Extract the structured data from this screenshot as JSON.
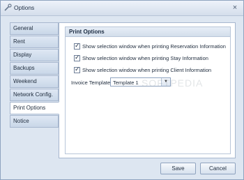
{
  "window": {
    "title": "Options",
    "close_symbol": "×"
  },
  "tabs": [
    {
      "label": "General",
      "active": false
    },
    {
      "label": "Rent",
      "active": false
    },
    {
      "label": "Display",
      "active": false
    },
    {
      "label": "Backups",
      "active": false
    },
    {
      "label": "Weekend",
      "active": false
    },
    {
      "label": "Network Config.",
      "active": false
    },
    {
      "label": "Print Options",
      "active": true
    },
    {
      "label": "Notice",
      "active": false
    }
  ],
  "print_options": {
    "header": "Print Options",
    "checkboxes": [
      {
        "label": "Show selection window when printing Reservation Information",
        "checked": true
      },
      {
        "label": "Show selection window when printing Stay Information",
        "checked": true
      },
      {
        "label": "Show selection window when printing Client Information",
        "checked": true
      }
    ],
    "invoice_template": {
      "label": "Invoice Template:",
      "value": "Template 1"
    },
    "check_mark": "✓",
    "dropdown_arrow": "▼"
  },
  "buttons": {
    "save": "Save",
    "cancel": "Cancel"
  },
  "watermark": "SOFTPEDIA"
}
